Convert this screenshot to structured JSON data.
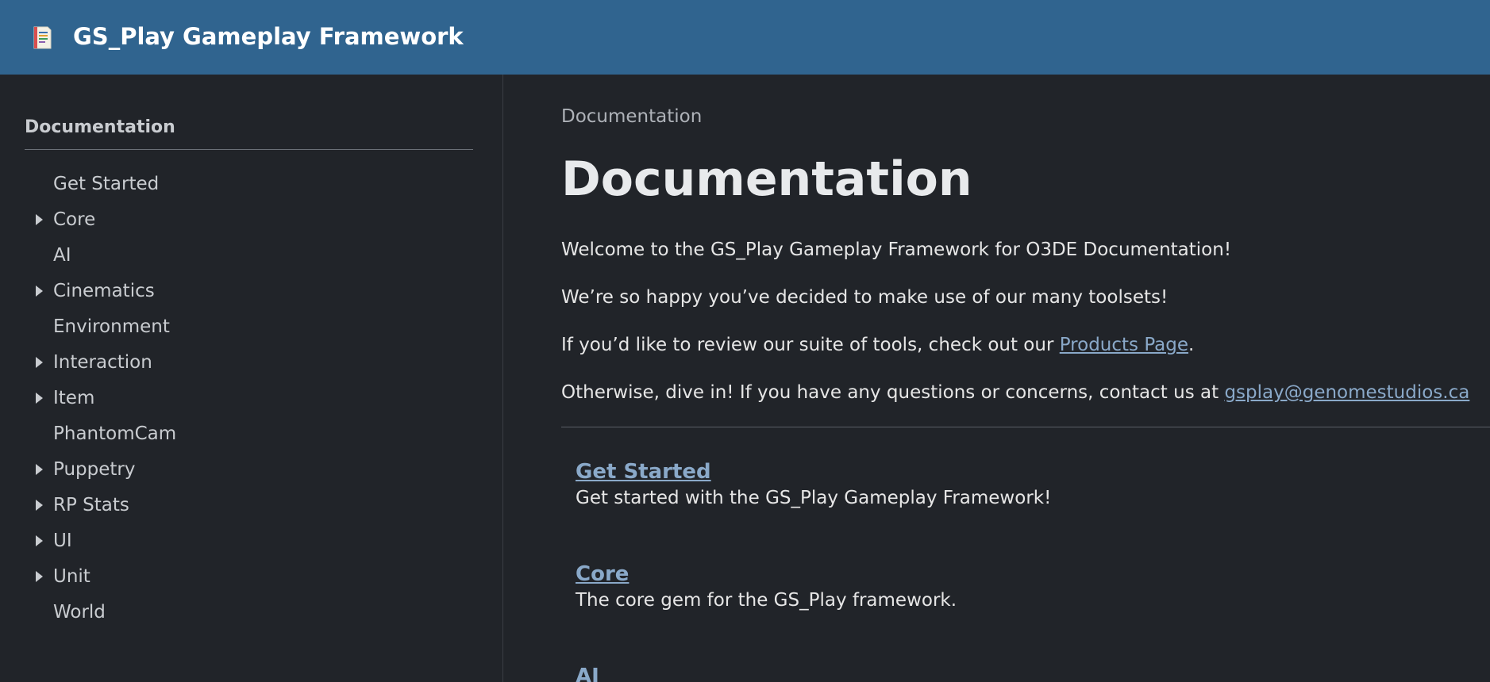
{
  "header": {
    "site_title": "GS_Play Gameplay Framework",
    "logo_icon": "notebook-icon",
    "background_color": "#30648f"
  },
  "sidebar": {
    "heading": "Documentation",
    "items": [
      {
        "label": "Get Started",
        "expandable": false
      },
      {
        "label": "Core",
        "expandable": true
      },
      {
        "label": "AI",
        "expandable": false
      },
      {
        "label": "Cinematics",
        "expandable": true
      },
      {
        "label": "Environment",
        "expandable": false
      },
      {
        "label": "Interaction",
        "expandable": true
      },
      {
        "label": "Item",
        "expandable": true
      },
      {
        "label": "PhantomCam",
        "expandable": false
      },
      {
        "label": "Puppetry",
        "expandable": true
      },
      {
        "label": "RP Stats",
        "expandable": true
      },
      {
        "label": "UI",
        "expandable": true
      },
      {
        "label": "Unit",
        "expandable": true
      },
      {
        "label": "World",
        "expandable": false
      }
    ]
  },
  "main": {
    "breadcrumb": "Documentation",
    "title": "Documentation",
    "paragraphs": {
      "welcome": "Welcome to the GS_Play Gameplay Framework for O3DE Documentation!",
      "happy": "We’re so happy you’ve decided to make use of our many toolsets!",
      "review_prefix": "If you’d like to review our suite of tools, check out our ",
      "review_link": "Products Page",
      "review_suffix": ".",
      "contact_prefix": "Otherwise, dive in! If you have any questions or concerns, contact us at ",
      "contact_link": "gsplay@genomestudios.ca"
    },
    "sections": [
      {
        "title": "Get Started",
        "description": "Get started with the GS_Play Gameplay Framework!"
      },
      {
        "title": "Core",
        "description": "The core gem for the GS_Play framework."
      },
      {
        "title": "AI",
        "description": ""
      }
    ]
  }
}
